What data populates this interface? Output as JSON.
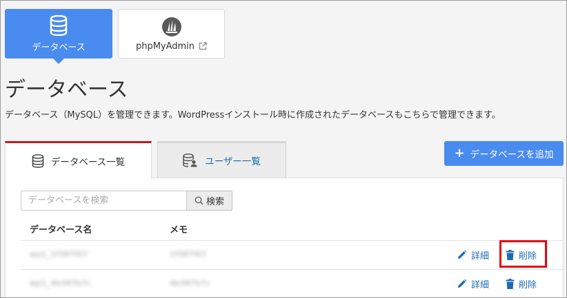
{
  "tools": {
    "database": {
      "label": "データベース",
      "icon": "database-icon"
    },
    "phpmyadmin": {
      "label": "phpMyAdmin",
      "icon": "sailboat-logo-icon",
      "external_icon": "external-link-icon"
    }
  },
  "page": {
    "title": "データベース",
    "description": "データベース（MySQL）を管理できます。WordPressインストール時に作成されたデータベースもこちらで管理できます。"
  },
  "tabs": [
    {
      "label": "データベース一覧",
      "active": true,
      "icon": "database-icon"
    },
    {
      "label": "ユーザー一覧",
      "active": false,
      "icon": "database-user-icon"
    }
  ],
  "add_button": {
    "label": "データベースを追加",
    "icon": "plus-icon"
  },
  "search": {
    "placeholder": "データベースを検索",
    "button_label": "検索",
    "icon": "search-icon"
  },
  "table": {
    "columns": [
      "データベース名",
      "メモ"
    ],
    "rows": [
      {
        "name": "wp1_1f387f07",
        "memo": "1f387f07",
        "detail_label": "詳細",
        "delete_label": "削除"
      },
      {
        "name": "wp1_4b387b7c",
        "memo": "4b387b7c",
        "detail_label": "詳細",
        "delete_label": "削除"
      }
    ]
  },
  "colors": {
    "accent": "#4a8bef",
    "link": "#1d6ab0",
    "active_tab_border": "#c51a1a",
    "highlight": "#e8000c"
  }
}
